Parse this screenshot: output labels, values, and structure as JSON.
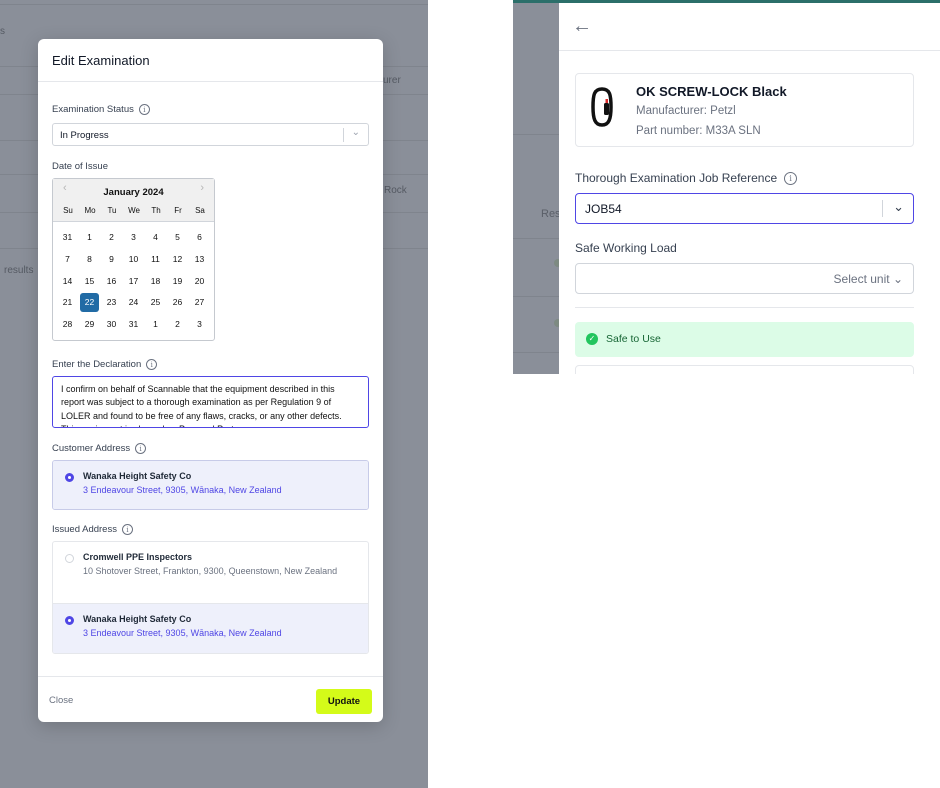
{
  "left_background": {
    "column_header_fragment": "urer",
    "row_fragment": "Rock",
    "results_fragment": "results",
    "edge_fragment": "s"
  },
  "modal": {
    "title": "Edit Examination",
    "status": {
      "label": "Examination Status",
      "value": "In Progress"
    },
    "date": {
      "label": "Date of Issue",
      "month_label": "January 2024",
      "weekdays": [
        "Su",
        "Mo",
        "Tu",
        "We",
        "Th",
        "Fr",
        "Sa"
      ],
      "weeks": [
        [
          "31",
          "1",
          "2",
          "3",
          "4",
          "5",
          "6"
        ],
        [
          "7",
          "8",
          "9",
          "10",
          "11",
          "12",
          "13"
        ],
        [
          "14",
          "15",
          "16",
          "17",
          "18",
          "19",
          "20"
        ],
        [
          "21",
          "22",
          "23",
          "24",
          "25",
          "26",
          "27"
        ],
        [
          "28",
          "29",
          "30",
          "31",
          "1",
          "2",
          "3"
        ]
      ],
      "selected_day": "22"
    },
    "declaration": {
      "label": "Enter the Declaration",
      "text": "I confirm on behalf of Scannable that the equipment described in this report was subject to a thorough examination as per Regulation 9 of LOLER and found to be free of any flaws, cracks, or any other defects. This equipment is classed as Personal Prote"
    },
    "customer_address": {
      "label": "Customer Address",
      "options": [
        {
          "name": "Wanaka Height Safety Co",
          "line": "3 Endeavour Street, 9305, Wānaka, New Zealand",
          "selected": true
        }
      ]
    },
    "issued_address": {
      "label": "Issued Address",
      "options": [
        {
          "name": "Cromwell PPE Inspectors",
          "line": "10 Shotover Street, Frankton, 9300, Queenstown, New Zealand",
          "selected": false
        },
        {
          "name": "Wanaka Height Safety Co",
          "line": "3 Endeavour Street, 9305, Wānaka, New Zealand",
          "selected": true
        }
      ]
    },
    "close_label": "Close",
    "update_label": "Update"
  },
  "right_panel": {
    "product": {
      "name": "OK SCREW-LOCK Black",
      "manufacturer": "Manufacturer: Petzl",
      "part_number": "Part number: M33A SLN"
    },
    "job_reference": {
      "label": "Thorough Examination Job Reference",
      "value": "JOB54"
    },
    "safe_working_load": {
      "label": "Safe Working Load",
      "unit_placeholder": "Select unit"
    },
    "status_banner": "Safe to Use",
    "background_fragment": "Res"
  },
  "colors": {
    "accent": "#4f46e5",
    "update_button": "#d4fb19",
    "calendar_selected": "#216ba5",
    "safe_banner": "#dcfce7",
    "safe_check": "#22c55e",
    "overlay": "#8a8f99"
  },
  "icons": {
    "info": "info-circle-icon",
    "chevron": "chevron-down-icon",
    "back": "arrow-left-icon",
    "carabiner": "carabiner-icon",
    "check": "check-circle-icon"
  }
}
